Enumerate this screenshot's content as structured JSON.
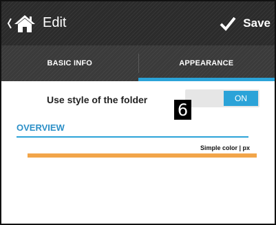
{
  "actionbar": {
    "title": "Edit",
    "save_label": "Save"
  },
  "tabs": [
    {
      "label": "BASIC INFO",
      "active": false
    },
    {
      "label": "APPEARANCE",
      "active": true
    }
  ],
  "settings": {
    "use_folder_style_label": "Use style of the folder",
    "toggle_state": "ON"
  },
  "callout": "6",
  "overview": {
    "header": "OVERVIEW",
    "style_summary": "Simple color | px",
    "color": "#f2a54a"
  },
  "colors": {
    "accent": "#2ba3d8",
    "actionbar": "#2b2b2b",
    "tabs": "#3a3a3a"
  },
  "icons": [
    "back-chevron-icon",
    "home-icon",
    "check-icon"
  ]
}
